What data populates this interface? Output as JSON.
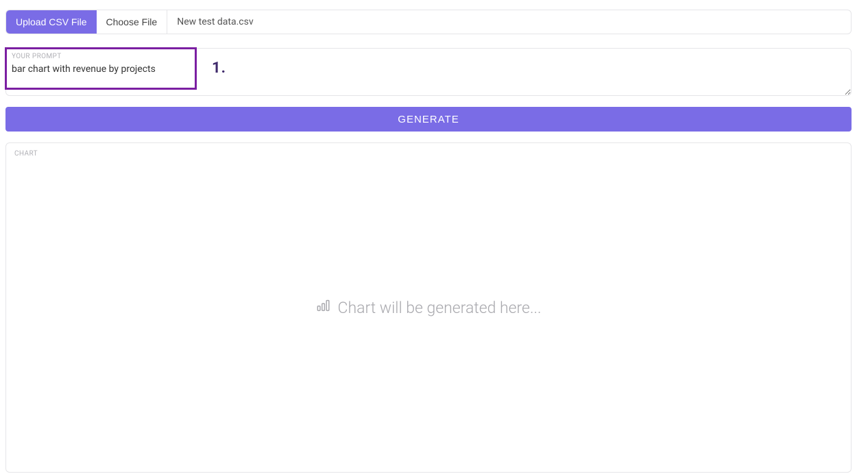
{
  "upload": {
    "upload_btn_label": "Upload CSV File",
    "choose_file_label": "Choose File",
    "filename": "New test data.csv"
  },
  "prompt": {
    "label": "YOUR PROMPT",
    "value": "bar chart with revenue by projects"
  },
  "annotation": {
    "text": "1."
  },
  "generate": {
    "label": "GENERATE"
  },
  "chart": {
    "label": "CHART",
    "placeholder": "Chart will be generated here..."
  }
}
